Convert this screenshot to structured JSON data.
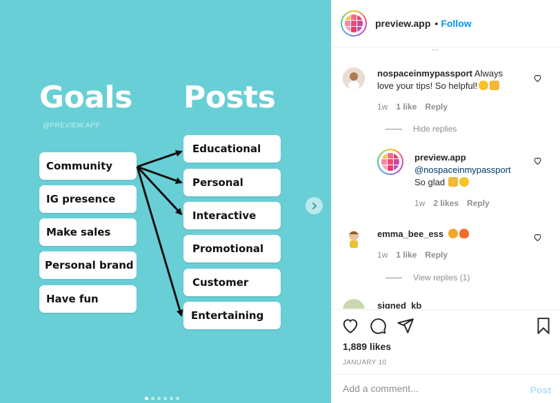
{
  "media": {
    "heading_left": "Goals",
    "heading_right": "Posts",
    "watermark": "@PREVIEW.APP",
    "goals": [
      "Community",
      "IG presence",
      "Make sales",
      "Personal brand",
      "Have fun"
    ],
    "posts": [
      "Educational",
      "Personal",
      "Interactive",
      "Promotional",
      "Customer",
      "Entertaining"
    ],
    "slide_count": 6,
    "active_slide": 1,
    "background_color": "#69cfd6",
    "next_icon": "chevron-right-icon"
  },
  "header": {
    "username": "preview.app",
    "separator": "•",
    "follow_label": "Follow",
    "accent_color": "#0095f6"
  },
  "comments": {
    "cut_off_text": "...",
    "items": [
      {
        "username": "nospaceinmypassport",
        "text": "Always love your tips! So helpful!",
        "emojis": [
          "smiling-face-icon",
          "raising-hands-icon"
        ],
        "time": "1w",
        "likes": "1 like",
        "reply_label": "Reply"
      }
    ],
    "hide_replies_label": "Hide replies",
    "reply": {
      "username": "preview.app",
      "mention": "@nospaceinmypassport",
      "text": "So glad",
      "emojis": [
        "raising-hands-icon",
        "winking-face-icon"
      ],
      "time": "1w",
      "likes": "2 likes",
      "reply_label": "Reply"
    },
    "second": {
      "username": "emma_bee_ess",
      "emojis": [
        "heart-eyes-icon",
        "fire-icon"
      ],
      "time": "1w",
      "likes": "1 like",
      "reply_label": "Reply",
      "view_replies_label": "View replies (1)"
    },
    "third_partial": {
      "username": "signed_kb"
    }
  },
  "actions": {
    "likes_count": "1,889 likes",
    "date": "JANUARY 10"
  },
  "add_comment": {
    "placeholder": "Add a comment...",
    "post_label": "Post"
  }
}
